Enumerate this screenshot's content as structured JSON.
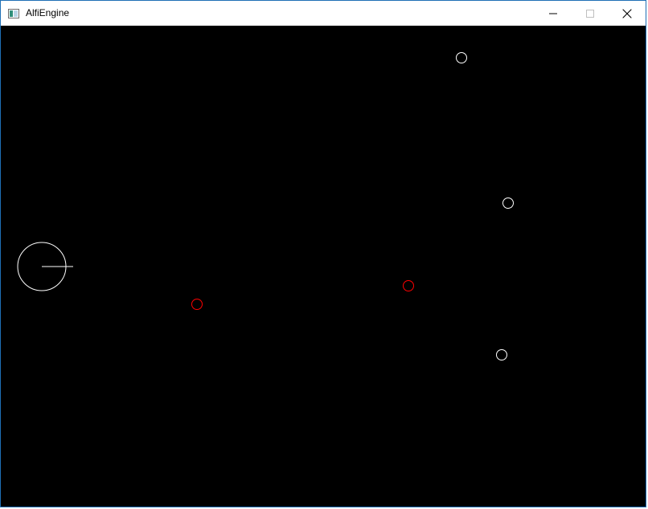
{
  "window": {
    "title": "AlfiEngine",
    "app_icon": "app-window-icon",
    "controls": [
      {
        "name": "minimize",
        "icon": "minimize-icon"
      },
      {
        "name": "maximize",
        "icon": "maximize-icon"
      },
      {
        "name": "close",
        "icon": "close-icon"
      }
    ]
  },
  "scene": {
    "background": "#000000",
    "player": {
      "color": "#ffffff",
      "shape": "circle-with-heading-line"
    },
    "white_orbs": {
      "color": "#ffffff",
      "count": 3
    },
    "red_orbs": {
      "color": "#ff0000",
      "count": 2
    }
  }
}
